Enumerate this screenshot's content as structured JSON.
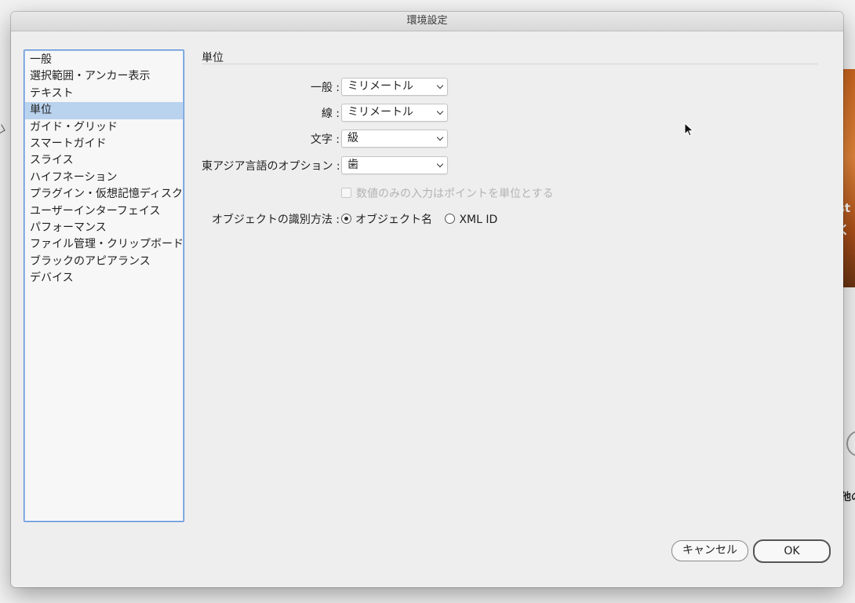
{
  "dialog": {
    "title": "環境設定"
  },
  "sidebar": {
    "items": [
      {
        "label": "一般",
        "selected": false
      },
      {
        "label": "選択範囲・アンカー表示",
        "selected": false
      },
      {
        "label": "テキスト",
        "selected": false
      },
      {
        "label": "単位",
        "selected": true
      },
      {
        "label": "ガイド・グリッド",
        "selected": false
      },
      {
        "label": "スマートガイド",
        "selected": false
      },
      {
        "label": "スライス",
        "selected": false
      },
      {
        "label": "ハイフネーション",
        "selected": false
      },
      {
        "label": "プラグイン・仮想記憶ディスク",
        "selected": false
      },
      {
        "label": "ユーザーインターフェイス",
        "selected": false
      },
      {
        "label": "パフォーマンス",
        "selected": false
      },
      {
        "label": "ファイル管理・クリップボード",
        "selected": false
      },
      {
        "label": "ブラックのアピアランス",
        "selected": false
      },
      {
        "label": "デバイス",
        "selected": false
      }
    ]
  },
  "units": {
    "section_title": "単位",
    "general_label": "一般 :",
    "general_value": "ミリメートル",
    "stroke_label": "線 :",
    "stroke_value": "ミリメートル",
    "type_label": "文字 :",
    "type_value": "級",
    "east_asian_label": "東アジア言語のオプション :",
    "east_asian_value": "歯",
    "numbers_checkbox_label": "数値のみの入力はポイントを単位とする",
    "identify_label": "オブジェクトの識別方法 :",
    "identify_option_name": "オブジェクト名",
    "identify_option_xml": "XML ID"
  },
  "buttons": {
    "cancel": "キャンセル",
    "ok": "OK"
  },
  "background": {
    "photo_text_1": "st",
    "photo_text_2": "く",
    "side_text": "他の"
  },
  "colors": {
    "selection": "#b9d2ee",
    "focus_ring": "#5a8ed6"
  }
}
